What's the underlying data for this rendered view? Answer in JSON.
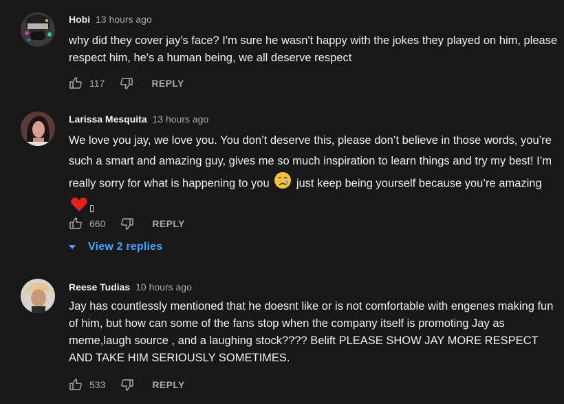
{
  "comments": [
    {
      "author": "Hobi",
      "time": "13 hours ago",
      "text": "why did they cover jay's face? I'm sure he wasn't happy with the jokes they played on him, please respect him, he's a human being, we all deserve respect",
      "likes": "117",
      "reply_label": "REPLY"
    },
    {
      "author": "Larissa Mesquita",
      "time": "13 hours ago",
      "text_part1": "We love you jay, we love you. You don’t deserve this, please don’t believe in those words, you’re such a smart and amazing guy, gives me so much inspiration to learn things and try my best! I’m really sorry for what is happening to you",
      "text_part2": "just keep being yourself because you’re amazing",
      "text_tail": "▯",
      "likes": "660",
      "reply_label": "REPLY",
      "replies_toggle": "View 2 replies"
    },
    {
      "author": "Reese Tudias",
      "time": "10 hours ago",
      "text": "Jay has countlessly mentioned that he doesnt like or is not comfortable with engenes making fun of him, but how can some of the fans stop when the company itself is promoting Jay as meme,laugh source , and a laughing stock???? Belift PLEASE SHOW JAY MORE RESPECT AND TAKE HIM SERIOUSLY SOMETIMES.",
      "likes": "533",
      "reply_label": "REPLY"
    }
  ],
  "icons": {
    "like": "thumbs-up-icon",
    "dislike": "thumbs-down-icon",
    "crying": "crying-face-emoji",
    "heart": "red-heart-emoji",
    "caret": "caret-down-icon"
  },
  "colors": {
    "background": "#181818",
    "text": "#f1f1f1",
    "secondary": "#aaaaaa",
    "link": "#3ea6ff"
  }
}
